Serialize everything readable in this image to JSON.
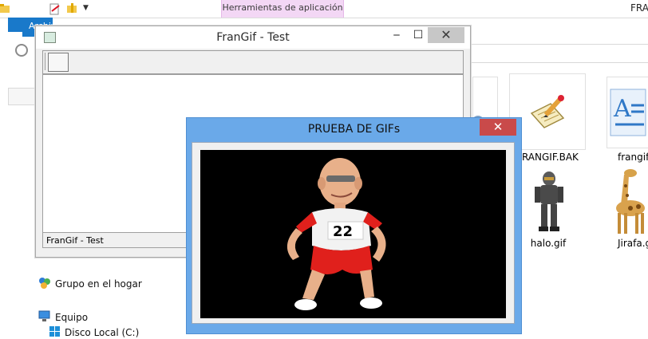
{
  "explorer": {
    "ribbon_context_tab": "Herramientas de aplicación",
    "window_title_partial": "FRA",
    "file_tab_label": "Archivo",
    "files": [
      {
        "name": "FRANGIF.BAK",
        "icon": "notepad-pencil-icon"
      },
      {
        "name": "frangif",
        "icon": "wordpad-document-icon"
      },
      {
        "name": "halo.gif",
        "icon": "halo-soldier-image"
      },
      {
        "name": "Jirafa.g",
        "icon": "giraffe-image"
      }
    ],
    "nav": [
      {
        "label": "Grupo en el hogar",
        "icon": "homegroup-icon"
      },
      {
        "label": "Equipo",
        "icon": "computer-icon"
      },
      {
        "label": "Disco Local (C:)",
        "icon": "windows-drive-icon"
      }
    ]
  },
  "frangif_window": {
    "title": "FranGif - Test",
    "minimize_label": "‒",
    "maximize_label": "☐",
    "close_label": "✕",
    "status_text": "FranGif - Test"
  },
  "prueba_window": {
    "title": "PRUEBA DE GIFs",
    "close_label": "✕",
    "gif_bib_number": "22",
    "colors": {
      "canvas": "#000000",
      "shirt": "#ffffff",
      "shorts": "#e0201c"
    }
  }
}
